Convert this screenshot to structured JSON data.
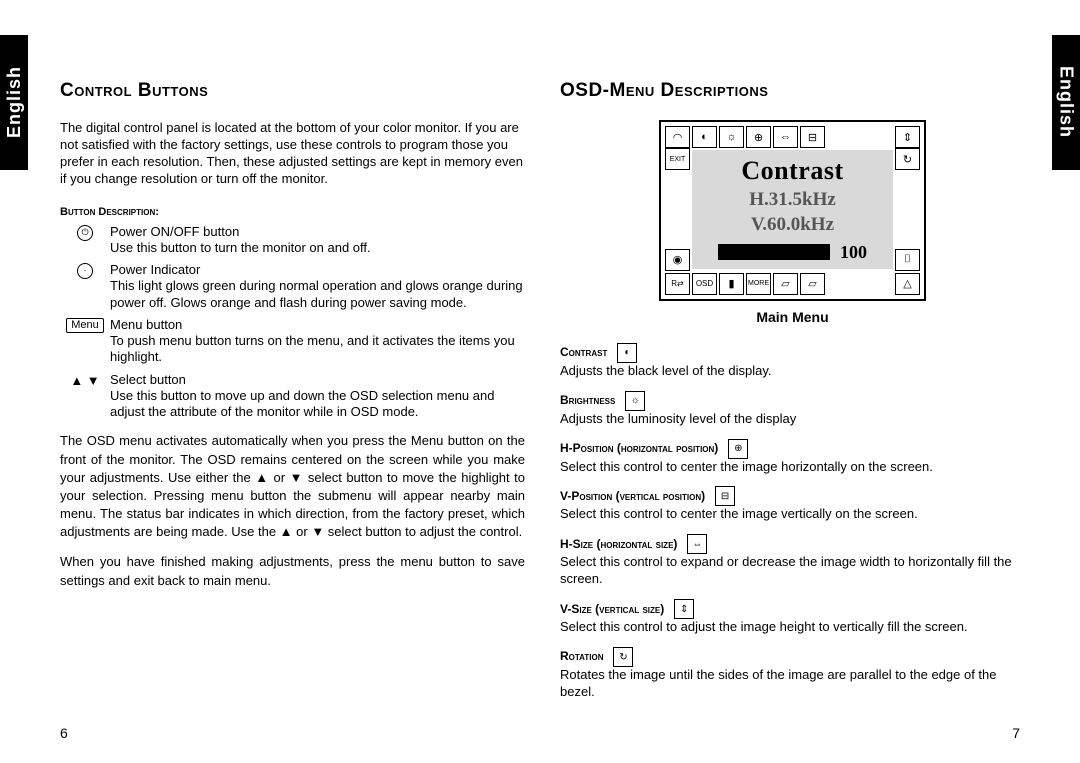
{
  "lang_tab": "English",
  "left": {
    "heading": "Control Buttons",
    "intro": "The digital control panel is located at the bottom of your color monitor. If you are not satisfied with the factory settings, use these controls to program those you prefer in each resolution. Then, these adjusted settings are kept in memory even if you change resolution or turn off the monitor.",
    "bd_head": "Button Description:",
    "rows": [
      {
        "label": "Power ON/OFF button",
        "desc": "Use this button to turn the monitor on and off."
      },
      {
        "label": "Power Indicator",
        "desc": "This light glows green during normal operation and glows orange during power off. Glows orange and flash during power saving mode."
      },
      {
        "label": "Menu button",
        "desc": "To push menu button turns on the menu, and it activates the items you highlight."
      },
      {
        "label": "Select button",
        "desc": "Use this button to move up and down the OSD selection menu and adjust the attribute of the monitor while in OSD mode."
      }
    ],
    "para2": "The OSD menu activates automatically when you press the Menu button on the front of the monitor. The OSD remains centered on the screen while you make your adjustments. Use either the ▲ or ▼ select button to move the highlight to your selection. Pressing menu button the submenu will appear nearby main menu. The status bar indicates in which direction, from the factory preset, which adjustments are being made. Use the ▲ or ▼ select button to adjust the control.",
    "para3": "When you have finished making adjustments, press the menu button to save settings and exit back to main menu.",
    "page": "6"
  },
  "right": {
    "heading": "OSD-Menu Descriptions",
    "osd": {
      "title": "Contrast",
      "h": "H.31.5kHz",
      "v": "V.60.0kHz",
      "value": "100"
    },
    "main_menu_label": "Main Menu",
    "items": [
      {
        "label": "Contrast",
        "desc": "Adjusts the black level of the display."
      },
      {
        "label": "Brightness",
        "desc": "Adjusts the luminosity level of the display"
      },
      {
        "label": "H-Position (horizontal position)",
        "desc": "Select this control to center the image horizontally on the screen."
      },
      {
        "label": "V-Position (vertical position)",
        "desc": "Select this control to center the image vertically on the screen."
      },
      {
        "label": "H-Size (horizontal size)",
        "desc": "Select this control to expand or decrease the image width to horizontally fill the screen."
      },
      {
        "label": "V-Size (vertical size)",
        "desc": "Select this control to adjust the image height to vertically fill the screen."
      },
      {
        "label": "Rotation",
        "desc": "Rotates the image until the sides of the image are parallel to the edge of the bezel."
      }
    ],
    "page": "7"
  },
  "bottom_icons": [
    "R⇄",
    "OSD",
    "▮",
    "MORE"
  ]
}
